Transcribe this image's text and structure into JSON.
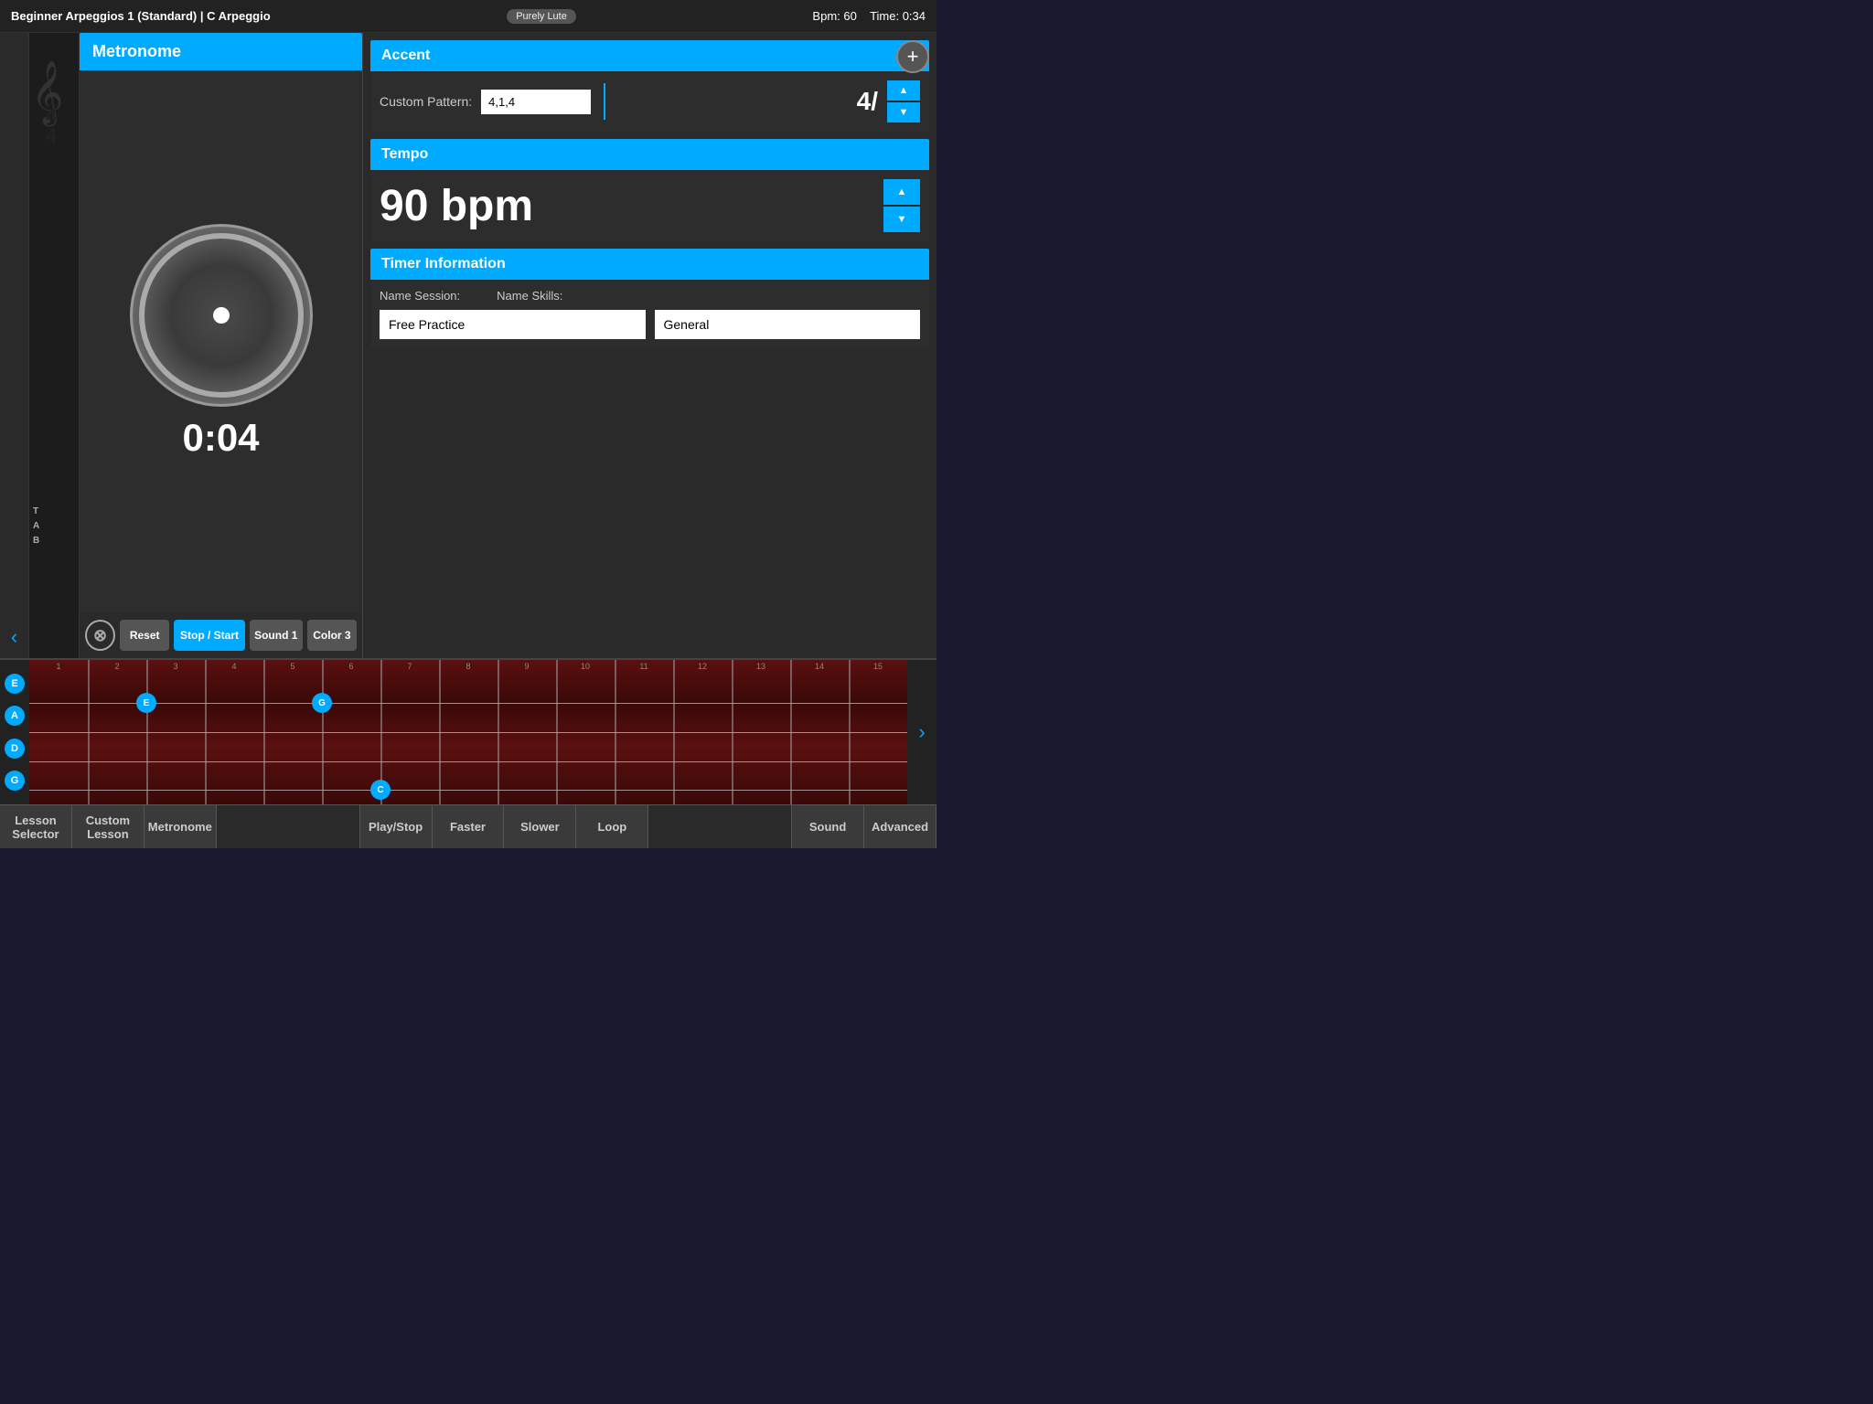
{
  "topbar": {
    "title": "Beginner Arpeggios 1 (Standard)  |  C Arpeggio",
    "logo": "Purely Lute",
    "bpm_label": "Bpm: 60",
    "time_label": "Time: 0:34"
  },
  "metronome": {
    "header": "Metronome",
    "time": "0:04",
    "controls": {
      "cancel": "⊗",
      "reset": "Reset",
      "stop_start": "Stop / Start",
      "sound": "Sound 1",
      "color": "Color 3"
    }
  },
  "accent": {
    "header": "Accent",
    "custom_pattern_label": "Custom Pattern:",
    "pattern_value": "4,1,4",
    "display": "4/",
    "up": "▲",
    "down": "▼"
  },
  "tempo": {
    "header": "Tempo",
    "value": "90 bpm",
    "up": "▲",
    "down": "▼"
  },
  "timer": {
    "header": "Timer Information",
    "name_session_label": "Name Session:",
    "name_skills_label": "Name Skills:",
    "session_value": "Free Practice",
    "skills_value": "General"
  },
  "fretboard": {
    "strings": [
      "E",
      "A",
      "D",
      "G"
    ],
    "notes": [
      {
        "label": "E",
        "string": 1,
        "fret": 2
      },
      {
        "label": "G",
        "string": 1,
        "fret": 5
      },
      {
        "label": "C",
        "string": 3,
        "fret": 6
      }
    ],
    "fret_numbers": [
      "1",
      "2",
      "3",
      "4",
      "5",
      "6",
      "7",
      "8",
      "9",
      "10",
      "11",
      "12",
      "13",
      "14",
      "15"
    ]
  },
  "toolbar": {
    "lesson_selector": "Lesson Selector",
    "custom_lesson": "Custom Lesson",
    "metronome": "Metronome",
    "play_stop": "Play/Stop",
    "faster": "Faster",
    "slower": "Slower",
    "loop": "Loop",
    "sound": "Sound",
    "advanced": "Advanced"
  },
  "sheet": {
    "tab_letters": "T\nA\nB"
  },
  "add_button": "+"
}
